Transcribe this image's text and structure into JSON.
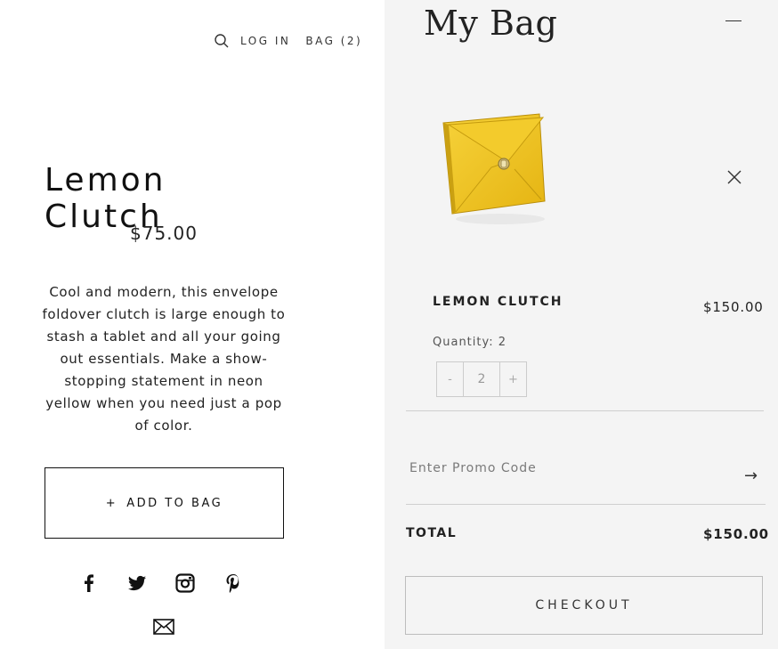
{
  "nav": {
    "login_label": "LOG IN",
    "bag_label": "BAG (2)"
  },
  "product": {
    "title": "Lemon Clutch",
    "price": "$75.00",
    "description": "Cool and modern, this envelope foldover clutch is large enough to stash a tablet and all your going out essentials. Make a show-stopping statement in neon yellow when you need just a pop of color.",
    "add_plus": "+",
    "add_label": "ADD TO BAG"
  },
  "bag": {
    "title": "My Bag",
    "item": {
      "name": "LEMON CLUTCH",
      "price": "$150.00",
      "quantity_label": "Quantity: 2",
      "quantity_value": "2",
      "decrement_label": "-",
      "increment_label": "+"
    },
    "promo_placeholder": "Enter Promo Code",
    "promo_arrow": "→",
    "total_label": "TOTAL",
    "total_value": "$150.00",
    "checkout_label": "CHECKOUT"
  },
  "colors": {
    "bag_panel_bg": "#f4f4f4",
    "clutch_yellow": "#f0c419"
  },
  "icons": [
    "search-icon",
    "facebook-icon",
    "twitter-icon",
    "instagram-icon",
    "pinterest-icon",
    "mail-icon",
    "close-icon",
    "minimize-icon",
    "arrow-right-icon"
  ]
}
